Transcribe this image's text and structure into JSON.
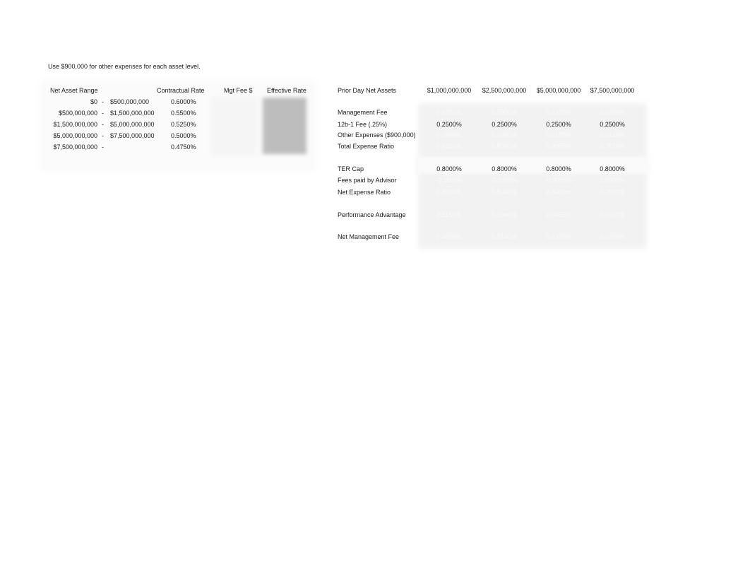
{
  "note": "Use $900,000 for other expenses for each asset level.",
  "fee_schedule": {
    "headers": {
      "range": "Net Asset Range",
      "contractual_rate": "Contractual Rate",
      "mgt_fee": "Mgt Fee $",
      "effective_rate": "Effective Rate"
    },
    "rows": [
      {
        "from": "$0",
        "dash": "-",
        "to": "$500,000,000",
        "rate": "0.6000%"
      },
      {
        "from": "$500,000,000",
        "dash": "-",
        "to": "$1,500,000,000",
        "rate": "0.5500%"
      },
      {
        "from": "$1,500,000,000",
        "dash": "-",
        "to": "$5,000,000,000",
        "rate": "0.5250%"
      },
      {
        "from": "$5,000,000,000",
        "dash": "-",
        "to": "$7,500,000,000",
        "rate": "0.5000%"
      },
      {
        "from": "$7,500,000,000",
        "dash": "-",
        "to": "",
        "rate": "0.4750%"
      }
    ]
  },
  "analysis": {
    "header_label": "Prior Day Net Assets",
    "columns": [
      "$1,000,000,000",
      "$2,500,000,000",
      "$5,000,000,000",
      "$7,500,000,000"
    ],
    "rows": [
      {
        "label": "Management Fee",
        "values": [
          "0.5750%",
          "0.5500%",
          "0.5375%",
          "0.5250%"
        ],
        "hidden": true
      },
      {
        "label": "12b-1 Fee (.25%)",
        "values": [
          "0.2500%",
          "0.2500%",
          "0.2500%",
          "0.2500%"
        ],
        "hidden": false
      },
      {
        "label": "Other Expenses ($900,000)",
        "values": [
          "0.0900%",
          "0.0360%",
          "0.0180%",
          "0.0120%"
        ],
        "hidden": true
      },
      {
        "label": "Total Expense Ratio",
        "values": [
          "0.9150%",
          "0.8360%",
          "0.8055%",
          "0.7870%"
        ],
        "hidden": true
      },
      {
        "label": "TER Cap",
        "values": [
          "0.8000%",
          "0.8000%",
          "0.8000%",
          "0.8000%"
        ],
        "hidden": false
      },
      {
        "label": "Fees paid by Advisor",
        "values": [
          "-0.1150%",
          "-0.0360%",
          "-0.0055%",
          "0.0000%"
        ],
        "hidden": true
      },
      {
        "label": "Net Expense Ratio",
        "values": [
          "0.8000%",
          "0.8000%",
          "0.8000%",
          "0.7870%"
        ],
        "hidden": true
      },
      {
        "label": "Performance Advantage",
        "values": [
          "0.1150%",
          "0.0360%",
          "0.0055%",
          "0.0000%"
        ],
        "hidden": true
      },
      {
        "label": "Net Management Fee",
        "values": [
          "0.4600%",
          "0.5140%",
          "0.5320%",
          "0.5250%"
        ],
        "hidden": true
      }
    ]
  }
}
